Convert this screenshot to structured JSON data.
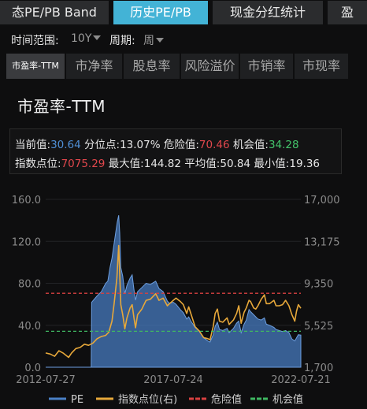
{
  "top_tabs": [
    "态PE/PB Band",
    "历史PE/PB",
    "现金分红统计",
    "盈"
  ],
  "filters": {
    "range_label": "时间范围:",
    "range_value": "10Y",
    "period_label": "周期:",
    "period_value": "周"
  },
  "sub_tabs": [
    "市盈率-TTM",
    "市净率",
    "股息率",
    "风险溢价",
    "市销率",
    "市现率"
  ],
  "chart_title": "市盈率-TTM",
  "stats": {
    "current_label": "当前值:",
    "current_value": "30.64",
    "percentile_label": "分位点:",
    "percentile_value": "13.07%",
    "danger_label": "危险值:",
    "danger_value": "70.46",
    "opportunity_label": "机会值:",
    "opportunity_value": "34.28",
    "index_label": "指数点位:",
    "index_value": "7075.29",
    "max_label": "最大值:",
    "max_value": "144.82",
    "avg_label": "平均值:",
    "avg_value": "50.84",
    "min_label": "最小值:",
    "min_value": "19.36"
  },
  "chart_data": {
    "type": "area",
    "title": "市盈率-TTM",
    "x_ticks": [
      "2012-07-27",
      "2017-07-24",
      "2022-07-21"
    ],
    "y_left_ticks": [
      "0.0",
      "40.0",
      "80.0",
      "120.0",
      "160.0"
    ],
    "y_left_range": [
      0,
      160
    ],
    "y_right_ticks": [
      "1,700",
      "5,525",
      "9,350",
      "13,175",
      "17,000"
    ],
    "y_right_range": [
      1700,
      17000
    ],
    "x_range": [
      "2012-07-27",
      "2022-07-21"
    ],
    "danger_value": 70.46,
    "opportunity_value": 34.28,
    "legend_position": "bottom",
    "series": [
      {
        "name": "PE",
        "color": "#4a80c6",
        "axis": "left",
        "points": [
          [
            "2012-07-27",
            0
          ],
          [
            "2014-05-01",
            0
          ],
          [
            "2014-05-08",
            0
          ],
          [
            "2014-05-15",
            62
          ],
          [
            "2014-08-01",
            68
          ],
          [
            "2014-10-01",
            72
          ],
          [
            "2014-12-01",
            80
          ],
          [
            "2015-01-01",
            82
          ],
          [
            "2015-02-01",
            95
          ],
          [
            "2015-03-01",
            104
          ],
          [
            "2015-04-01",
            118
          ],
          [
            "2015-05-15",
            138
          ],
          [
            "2015-06-05",
            144.8
          ],
          [
            "2015-06-20",
            128
          ],
          [
            "2015-07-05",
            95
          ],
          [
            "2015-08-01",
            87
          ],
          [
            "2015-09-01",
            70
          ],
          [
            "2015-10-01",
            78
          ],
          [
            "2015-11-15",
            85
          ],
          [
            "2015-12-15",
            88
          ],
          [
            "2016-01-10",
            74
          ],
          [
            "2016-02-01",
            64
          ],
          [
            "2016-03-01",
            72
          ],
          [
            "2016-05-01",
            76
          ],
          [
            "2016-07-01",
            80
          ],
          [
            "2016-09-01",
            79
          ],
          [
            "2016-11-15",
            82
          ],
          [
            "2017-01-01",
            75
          ],
          [
            "2017-03-01",
            72
          ],
          [
            "2017-05-01",
            63
          ],
          [
            "2017-06-01",
            61
          ],
          [
            "2017-07-24",
            62
          ],
          [
            "2017-09-01",
            60
          ],
          [
            "2017-11-01",
            55
          ],
          [
            "2017-12-15",
            52
          ],
          [
            "2018-02-01",
            46
          ],
          [
            "2018-03-01",
            48
          ],
          [
            "2018-04-01",
            44
          ],
          [
            "2018-06-01",
            38
          ],
          [
            "2018-08-01",
            34
          ],
          [
            "2018-10-01",
            28
          ],
          [
            "2018-12-01",
            25
          ],
          [
            "2019-01-01",
            24
          ],
          [
            "2019-02-15",
            31
          ],
          [
            "2019-03-15",
            39
          ],
          [
            "2019-04-15",
            43
          ],
          [
            "2019-05-15",
            36
          ],
          [
            "2019-07-01",
            35
          ],
          [
            "2019-09-01",
            37
          ],
          [
            "2019-10-01",
            33
          ],
          [
            "2019-12-01",
            37
          ],
          [
            "2020-01-15",
            42
          ],
          [
            "2020-02-15",
            44
          ],
          [
            "2020-03-20",
            33
          ],
          [
            "2020-05-01",
            41
          ],
          [
            "2020-06-01",
            45
          ],
          [
            "2020-07-10",
            55
          ],
          [
            "2020-08-01",
            53
          ],
          [
            "2020-09-15",
            50
          ],
          [
            "2020-10-15",
            48
          ],
          [
            "2020-11-15",
            46
          ],
          [
            "2021-01-01",
            45
          ],
          [
            "2021-02-15",
            47
          ],
          [
            "2021-03-15",
            41
          ],
          [
            "2021-05-01",
            40
          ],
          [
            "2021-07-01",
            38
          ],
          [
            "2021-08-01",
            36
          ],
          [
            "2021-09-15",
            35
          ],
          [
            "2021-11-01",
            34
          ],
          [
            "2021-12-15",
            35
          ],
          [
            "2022-02-01",
            33
          ],
          [
            "2022-03-15",
            27
          ],
          [
            "2022-04-25",
            25
          ],
          [
            "2022-05-20",
            28
          ],
          [
            "2022-06-15",
            31
          ],
          [
            "2022-07-21",
            30.64
          ]
        ]
      },
      {
        "name": "指数点位(右)",
        "color": "#e7a83a",
        "axis": "right",
        "points": [
          [
            "2012-07-27",
            3000
          ],
          [
            "2012-10-01",
            2900
          ],
          [
            "2012-12-01",
            2700
          ],
          [
            "2013-02-01",
            3200
          ],
          [
            "2013-04-01",
            3000
          ],
          [
            "2013-06-20",
            2600
          ],
          [
            "2013-08-01",
            3000
          ],
          [
            "2013-10-01",
            3400
          ],
          [
            "2013-12-01",
            3500
          ],
          [
            "2014-02-01",
            3800
          ],
          [
            "2014-04-01",
            3700
          ],
          [
            "2014-06-01",
            3900
          ],
          [
            "2014-08-01",
            4300
          ],
          [
            "2014-10-01",
            4500
          ],
          [
            "2014-12-01",
            4600
          ],
          [
            "2015-01-15",
            4900
          ],
          [
            "2015-03-01",
            5900
          ],
          [
            "2015-04-01",
            7500
          ],
          [
            "2015-05-10",
            9800
          ],
          [
            "2015-06-05",
            12800
          ],
          [
            "2015-06-20",
            10200
          ],
          [
            "2015-07-05",
            7400
          ],
          [
            "2015-08-01",
            6500
          ],
          [
            "2015-09-01",
            5200
          ],
          [
            "2015-10-01",
            6200
          ],
          [
            "2015-11-15",
            7100
          ],
          [
            "2015-12-15",
            7400
          ],
          [
            "2016-01-10",
            6200
          ],
          [
            "2016-02-01",
            5300
          ],
          [
            "2016-03-01",
            6500
          ],
          [
            "2016-05-01",
            7000
          ],
          [
            "2016-07-01",
            7800
          ],
          [
            "2016-09-01",
            7900
          ],
          [
            "2016-11-15",
            8400
          ],
          [
            "2017-01-01",
            7800
          ],
          [
            "2017-03-01",
            8000
          ],
          [
            "2017-05-01",
            7300
          ],
          [
            "2017-06-01",
            7500
          ],
          [
            "2017-07-24",
            7800
          ],
          [
            "2017-09-01",
            8000
          ],
          [
            "2017-11-01",
            7700
          ],
          [
            "2017-12-15",
            7400
          ],
          [
            "2018-02-01",
            6600
          ],
          [
            "2018-03-01",
            7200
          ],
          [
            "2018-04-01",
            6600
          ],
          [
            "2018-06-01",
            5400
          ],
          [
            "2018-08-01",
            5000
          ],
          [
            "2018-10-01",
            4400
          ],
          [
            "2018-12-01",
            4300
          ],
          [
            "2019-01-01",
            4200
          ],
          [
            "2019-02-15",
            5400
          ],
          [
            "2019-03-15",
            6600
          ],
          [
            "2019-04-15",
            7000
          ],
          [
            "2019-05-15",
            5900
          ],
          [
            "2019-07-01",
            5800
          ],
          [
            "2019-09-01",
            6200
          ],
          [
            "2019-10-01",
            5600
          ],
          [
            "2019-12-01",
            6000
          ],
          [
            "2020-01-15",
            6600
          ],
          [
            "2020-02-15",
            7300
          ],
          [
            "2020-03-20",
            5700
          ],
          [
            "2020-05-01",
            6700
          ],
          [
            "2020-06-01",
            7100
          ],
          [
            "2020-07-10",
            7800
          ],
          [
            "2020-08-01",
            7700
          ],
          [
            "2020-09-15",
            7100
          ],
          [
            "2020-10-15",
            7000
          ],
          [
            "2020-11-15",
            7300
          ],
          [
            "2021-01-01",
            7900
          ],
          [
            "2021-02-15",
            8300
          ],
          [
            "2021-03-15",
            7500
          ],
          [
            "2021-05-01",
            7500
          ],
          [
            "2021-07-01",
            7800
          ],
          [
            "2021-08-01",
            7300
          ],
          [
            "2021-09-15",
            7300
          ],
          [
            "2021-11-01",
            7400
          ],
          [
            "2021-12-15",
            7800
          ],
          [
            "2022-02-01",
            7300
          ],
          [
            "2022-03-15",
            6500
          ],
          [
            "2022-04-25",
            5900
          ],
          [
            "2022-05-20",
            6800
          ],
          [
            "2022-06-15",
            7400
          ],
          [
            "2022-07-21",
            7075
          ]
        ]
      },
      {
        "name": "危险值",
        "color": "#d94040",
        "axis": "left",
        "value": 70.46,
        "style": "dashed"
      },
      {
        "name": "机会值",
        "color": "#3fb862",
        "axis": "left",
        "value": 34.28,
        "style": "dashed"
      }
    ]
  }
}
